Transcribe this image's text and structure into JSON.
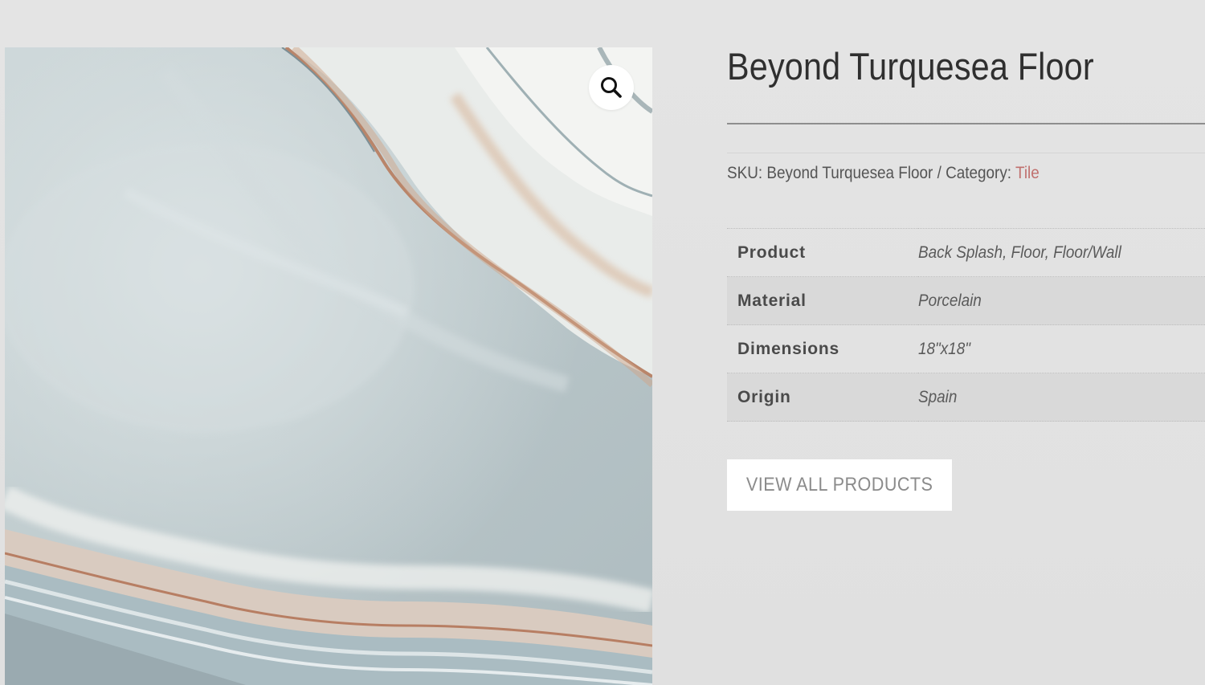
{
  "product": {
    "title": "Beyond Turquesea Floor",
    "sku_prefix": "SKU: ",
    "sku_value": "Beyond Turquesea Floor",
    "category_prefix": " / Category: ",
    "category_link": "Tile"
  },
  "attributes": [
    {
      "label": "Product",
      "value": "Back Splash, Floor, Floor/Wall"
    },
    {
      "label": "Material",
      "value": "Porcelain"
    },
    {
      "label": "Dimensions",
      "value": "18\"x18\""
    },
    {
      "label": "Origin",
      "value": "Spain"
    }
  ],
  "actions": {
    "view_all_label": "VIEW ALL PRODUCTS"
  },
  "icons": {
    "zoom": "magnifier-icon"
  },
  "colors": {
    "category_link": "#c0706e",
    "background": "#e2e2e2"
  }
}
